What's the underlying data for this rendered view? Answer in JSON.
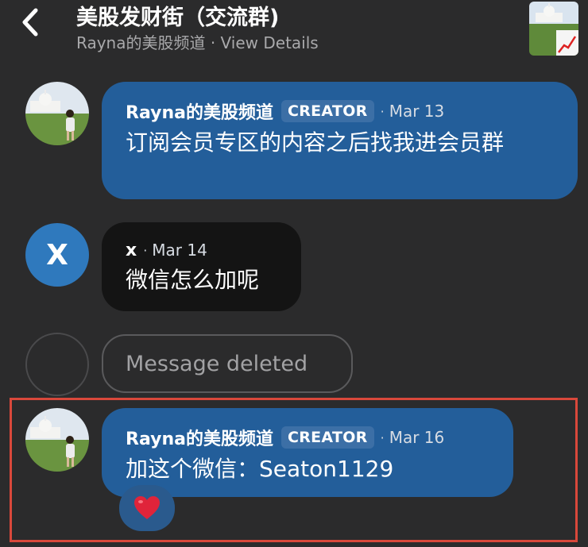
{
  "header": {
    "title": "美股发财街（交流群)",
    "subtitle": "Rayna的美股频道 · View Details",
    "back_icon": "chevron-left-icon",
    "thumbnail_icon": "group-photo-thumbnail"
  },
  "messages": [
    {
      "author": "Rayna的美股频道",
      "badge": "CREATOR",
      "dot": "·",
      "date": "Mar 13",
      "text": "订阅会员专区的内容之后找我进会员群",
      "avatar": "photo"
    },
    {
      "author": "x",
      "dot": "·",
      "date": "Mar 14",
      "text": "微信怎么加呢",
      "avatar_letter": "X"
    },
    {
      "deleted_text": "Message deleted"
    },
    {
      "author": "Rayna的美股频道",
      "badge": "CREATOR",
      "dot": "·",
      "date": "Mar 16",
      "text": "加这个微信：Seaton1129",
      "reaction": "❤️",
      "avatar": "photo"
    }
  ],
  "colors": {
    "background": "#2b2b2c",
    "bubble_blue": "#235e9a",
    "bubble_dark": "#141414",
    "avatar_blue": "#2f79bd",
    "highlight": "#d9483b",
    "heart": "#e0243a"
  }
}
